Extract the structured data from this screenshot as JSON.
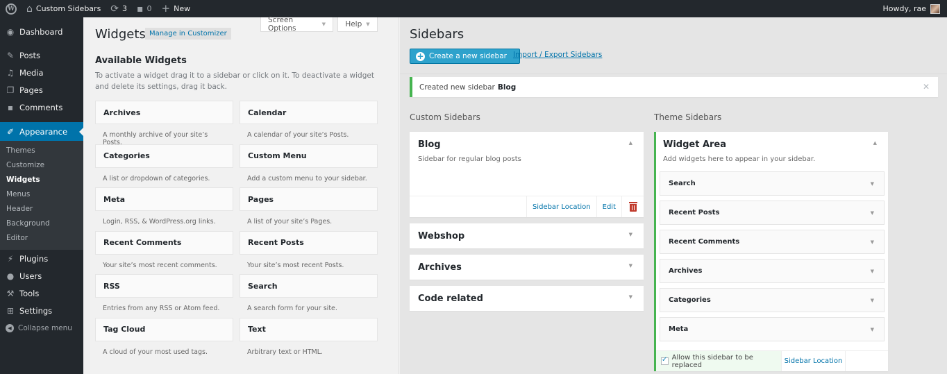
{
  "adminbar": {
    "site_name": "Custom Sidebars",
    "updates_count": "3",
    "comments_count": "0",
    "new_label": "New",
    "greeting": "Howdy, rae"
  },
  "menu": {
    "items": [
      {
        "label": "Dashboard",
        "icon": "dashboard-icon"
      },
      {
        "label": "Posts",
        "icon": "pin-icon"
      },
      {
        "label": "Media",
        "icon": "media-icon"
      },
      {
        "label": "Pages",
        "icon": "pages-icon"
      },
      {
        "label": "Comments",
        "icon": "comment-icon"
      },
      {
        "label": "Appearance",
        "icon": "paintbrush-icon"
      }
    ],
    "appearance_sub": [
      "Themes",
      "Customize",
      "Widgets",
      "Menus",
      "Header",
      "Background",
      "Editor"
    ],
    "items_after": [
      {
        "label": "Plugins",
        "icon": "plugin-icon"
      },
      {
        "label": "Users",
        "icon": "user-icon"
      },
      {
        "label": "Tools",
        "icon": "wrench-icon"
      },
      {
        "label": "Settings",
        "icon": "settings-icon"
      }
    ],
    "collapse_label": "Collapse menu"
  },
  "screen_meta": {
    "screen_options": "Screen Options",
    "help": "Help"
  },
  "widgets_page": {
    "title": "Widgets",
    "manage_customizer": "Manage in Customizer",
    "available_title": "Available Widgets",
    "available_desc": "To activate a widget drag it to a sidebar or click on it. To deactivate a widget and delete its settings, drag it back.",
    "widgets": [
      {
        "title": "Archives",
        "desc": "A monthly archive of your site’s Posts."
      },
      {
        "title": "Calendar",
        "desc": "A calendar of your site’s Posts."
      },
      {
        "title": "Categories",
        "desc": "A list or dropdown of categories."
      },
      {
        "title": "Custom Menu",
        "desc": "Add a custom menu to your sidebar."
      },
      {
        "title": "Meta",
        "desc": "Login, RSS, & WordPress.org links."
      },
      {
        "title": "Pages",
        "desc": "A list of your site’s Pages."
      },
      {
        "title": "Recent Comments",
        "desc": "Your site’s most recent comments."
      },
      {
        "title": "Recent Posts",
        "desc": "Your site’s most recent Posts."
      },
      {
        "title": "RSS",
        "desc": "Entries from any RSS or Atom feed."
      },
      {
        "title": "Search",
        "desc": "A search form for your site."
      },
      {
        "title": "Tag Cloud",
        "desc": "A cloud of your most used tags."
      },
      {
        "title": "Text",
        "desc": "Arbitrary text or HTML."
      }
    ]
  },
  "sidebars": {
    "title": "Sidebars",
    "create_button": "Create a new sidebar",
    "import_export": "Import / Export Sidebars",
    "notice_text": "Created new sidebar",
    "notice_name": "Blog",
    "custom_heading": "Custom Sidebars",
    "theme_heading": "Theme Sidebars",
    "custom": [
      {
        "name": "Blog",
        "desc": "Sidebar for regular blog posts",
        "location_label": "Sidebar Location",
        "edit_label": "Edit"
      },
      {
        "name": "Webshop"
      },
      {
        "name": "Archives"
      },
      {
        "name": "Code related"
      }
    ],
    "theme": {
      "name": "Widget Area",
      "desc": "Add widgets here to appear in your sidebar.",
      "widgets": [
        "Search",
        "Recent Posts",
        "Recent Comments",
        "Archives",
        "Categories",
        "Meta"
      ],
      "replace_label": "Allow this sidebar to be replaced",
      "replace_checked": true,
      "location_label": "Sidebar Location"
    }
  },
  "colors": {
    "adminbar_bg": "#23282d",
    "accent": "#0073aa",
    "button_blue": "#2ea2cc",
    "success_green": "#46b450",
    "trash_red": "#c0392b"
  }
}
